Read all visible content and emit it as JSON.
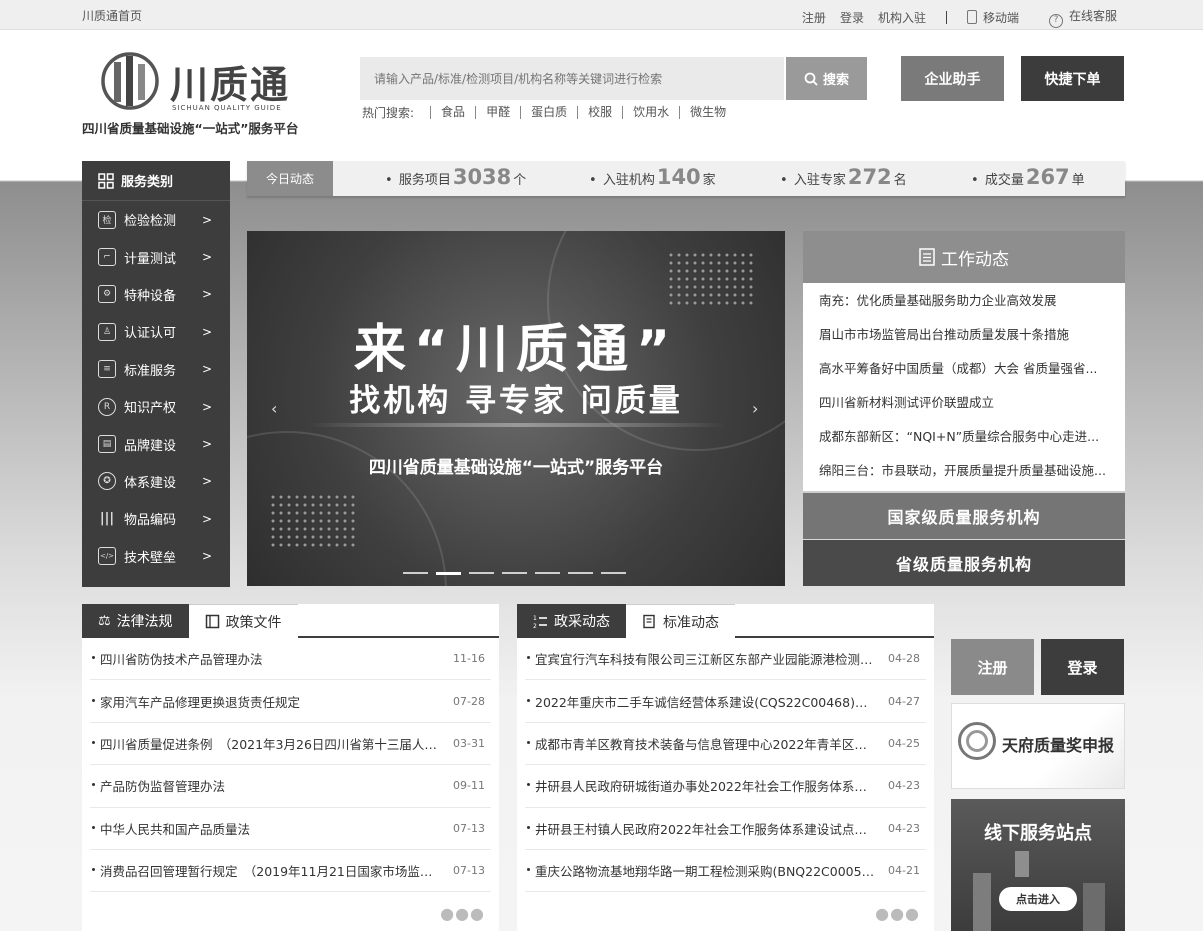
{
  "topbar": {
    "home": "川质通首页",
    "register": "注册",
    "login": "登录",
    "join": "机构入驻",
    "mobile": "移动端",
    "service": "在线客服"
  },
  "logo": {
    "title": "川质通",
    "en": "SICHUAN QUALITY GUIDE",
    "sub": "四川省质量基础设施“一站式”服务平台"
  },
  "search": {
    "placeholder": "请输入产品/标准/检测项目/机构名称等关键词进行检索",
    "button": "搜索",
    "hot_label": "热门搜索:",
    "hot": [
      "食品",
      "甲醛",
      "蛋白质",
      "校服",
      "饮用水",
      "微生物"
    ]
  },
  "header_buttons": {
    "assistant": "企业助手",
    "order": "快捷下单"
  },
  "sidebar": {
    "title": "服务类别",
    "items": [
      {
        "label": "检验检测",
        "icon": "检"
      },
      {
        "label": "计量测试",
        "icon": "⌐"
      },
      {
        "label": "特种设备",
        "icon": "⚙"
      },
      {
        "label": "认证认可",
        "icon": "♙"
      },
      {
        "label": "标准服务",
        "icon": "≡"
      },
      {
        "label": "知识产权",
        "icon": "R"
      },
      {
        "label": "品牌建设",
        "icon": "▤"
      },
      {
        "label": "体系建设",
        "icon": "✪"
      },
      {
        "label": "物品编码",
        "icon": "|||"
      },
      {
        "label": "技术壁垒",
        "icon": "</>"
      }
    ]
  },
  "stats": {
    "tag": "今日动态",
    "items": [
      {
        "label": "服务项目",
        "value": "3038",
        "unit": "个"
      },
      {
        "label": "入驻机构",
        "value": "140",
        "unit": "家"
      },
      {
        "label": "入驻专家",
        "value": "272",
        "unit": "名"
      },
      {
        "label": "成交量",
        "value": "267",
        "unit": "单"
      }
    ]
  },
  "banner": {
    "line1": "来“川质通”",
    "line2": "找机构 寻专家 问质量",
    "line3": "四川省质量基础设施“一站式”服务平台",
    "prev": "‹",
    "next": "›"
  },
  "work_news": {
    "title": "工作动态",
    "items": [
      "南充：优化质量基础服务助力企业高效发展",
      "眉山市市场监管局出台推动质量发展十条措施",
      "高水平筹备好中国质量（成都）大会 省质量强省...",
      "四川省新材料测试评价联盟成立",
      "成都东部新区：“NQI+N”质量综合服务中心走进...",
      "绵阳三台：市县联动，开展质量提升质量基础设施..."
    ]
  },
  "org_buttons": {
    "national": "国家级质量服务机构",
    "provincial": "省级质量服务机构"
  },
  "law_panel": {
    "tab_active": "法律法规",
    "tab_inactive": "政策文件",
    "items": [
      {
        "title": "四川省防伪技术产品管理办法",
        "date": "11-16"
      },
      {
        "title": "家用汽车产品修理更换退货责任规定",
        "date": "07-28"
      },
      {
        "title": "四川省质量促进条例　（2021年3月26日四川省第十三届人民...",
        "date": "03-31"
      },
      {
        "title": "产品防伪监督管理办法",
        "date": "09-11"
      },
      {
        "title": "中华人民共和国产品质量法",
        "date": "07-13"
      },
      {
        "title": "消费品召回管理暂行规定　（2019年11月21日国家市场监督管...",
        "date": "07-13"
      }
    ]
  },
  "procure_panel": {
    "tab_active": "政采动态",
    "tab_inactive": "标准动态",
    "items": [
      {
        "title": "宜宾宜行汽车科技有限公司三江新区东部产业园能源港检测项...",
        "date": "04-28"
      },
      {
        "title": "2022年重庆市二手车诚信经营体系建设(CQS22C00468)竞争...",
        "date": "04-27"
      },
      {
        "title": "成都市青羊区教育技术装备与信息管理中心2022年青羊区教室...",
        "date": "04-25"
      },
      {
        "title": "井研县人民政府研城街道办事处2022年社会工作服务体系建设...",
        "date": "04-23"
      },
      {
        "title": "井研县王村镇人民政府2022年社会工作服务体系建设试点项目...",
        "date": "04-23"
      },
      {
        "title": "重庆公路物流基地翔华路一期工程检测采购(BNQ22C00051)竞...",
        "date": "04-21"
      }
    ]
  },
  "right": {
    "register": "注册",
    "login": "登录",
    "award": "天府质量奖申报",
    "station": "线下服务站点",
    "enter": "点击进入"
  }
}
